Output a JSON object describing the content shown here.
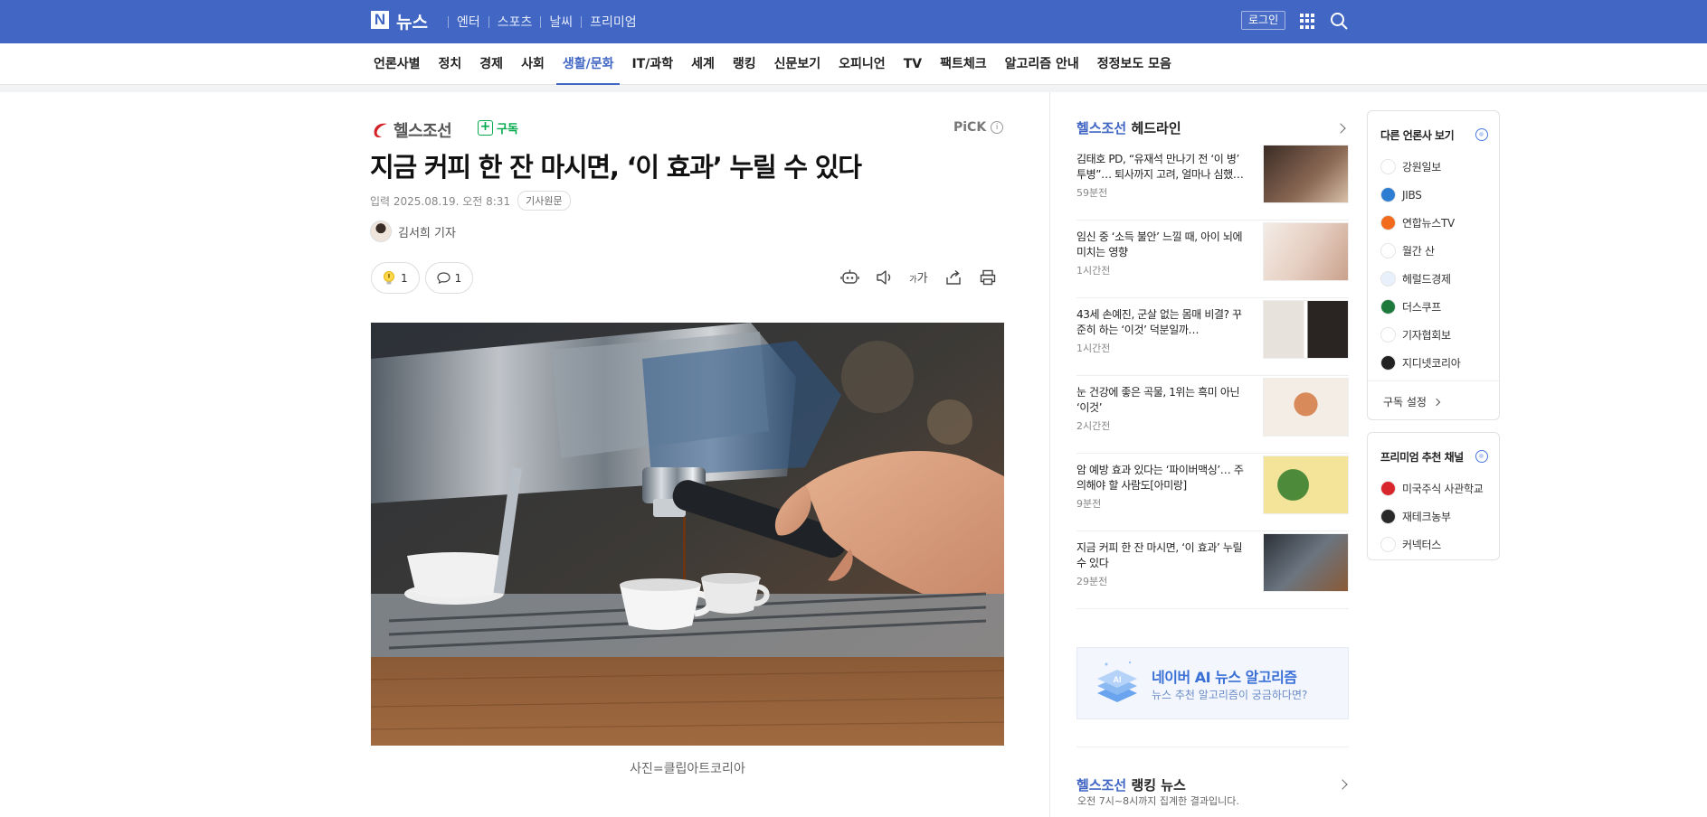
{
  "header": {
    "logo_letter": "N",
    "logo_text": "뉴스",
    "nav": [
      "엔터",
      "스포츠",
      "날씨",
      "프리미엄"
    ],
    "login_label": "로그인"
  },
  "section_nav": [
    "언론사별",
    "정치",
    "경제",
    "사회",
    "생활/문화",
    "IT/과학",
    "세계",
    "랭킹",
    "신문보기",
    "오피니언",
    "TV",
    "팩트체크",
    "알고리즘 안내",
    "정정보도 모음"
  ],
  "section_nav_active": "생활/문화",
  "article": {
    "press_name": "헬스조선",
    "subscribe_label": "구독",
    "pick_label": "PiCK",
    "title": "지금 커피 한 잔 마시면, ‘이 효과’ 누릴 수 있다",
    "date": "입력 2025.08.19. 오전 8:31",
    "original_label": "기사원문",
    "author": "김서희 기자",
    "reaction_count": "1",
    "comment_count": "1",
    "font_size_label": "가",
    "caption": "사진=클립아트코리아"
  },
  "sidebar": {
    "press_name": "헬스조선",
    "headline_label": "헤드라인",
    "items": [
      {
        "title": "김태호 PD, “유재석 만나기 전 ‘이 병’ 투병”… 퇴사까지 고려, 얼마나 심했길…",
        "time": "59분전"
      },
      {
        "title": "임신 중 ‘소득 불안’ 느낄 때, 아이 뇌에 미치는 영향",
        "time": "1시간전"
      },
      {
        "title": "43세 손예진, 군살 없는 몸매 비결? 꾸준히 하는 ‘이것’ 덕분일까…",
        "time": "1시간전"
      },
      {
        "title": "눈 건강에 좋은 곡물, 1위는 흑미 아닌 ‘이것’",
        "time": "2시간전"
      },
      {
        "title": "암 예방 효과 있다는 ‘파이버맥싱’… 주의해야 할 사람도[아미랑]",
        "time": "9분전"
      },
      {
        "title": "지금 커피 한 잔 마시면, ‘이 효과’ 누릴 수 있다",
        "time": "29분전"
      }
    ],
    "ai_title": "네이버 AI 뉴스 알고리즘",
    "ai_subtitle": "뉴스 추천 알고리즘이 궁금하다면?",
    "ai_icon_text": "AI",
    "ranking_label": "랭킹 뉴스",
    "ranking_sub": "오전 7시~8시까지 집계한 결과입니다."
  },
  "other_press": {
    "title": "다른 언론사 보기",
    "items": [
      {
        "name": "강원일보",
        "color": "#ffffff"
      },
      {
        "name": "JIBS",
        "color": "#2d7dd2"
      },
      {
        "name": "연합뉴스TV",
        "color": "#f26a1b"
      },
      {
        "name": "월간 산",
        "color": "#ffffff"
      },
      {
        "name": "헤럴드경제",
        "color": "#e8f1fb"
      },
      {
        "name": "더스쿠프",
        "color": "#1e7a3c"
      },
      {
        "name": "기자협회보",
        "color": "#ffffff"
      },
      {
        "name": "지디넷코리아",
        "color": "#222222"
      }
    ],
    "setting_label": "구독 설정"
  },
  "premium": {
    "title": "프리미엄 추천 채널",
    "items": [
      {
        "name": "미국주식 사관학교",
        "color": "#d9262d"
      },
      {
        "name": "재테크농부",
        "color": "#2a2a2a"
      },
      {
        "name": "커넥터스",
        "color": "#ffffff"
      }
    ]
  },
  "colors": {
    "brand_blue": "#4166c4",
    "subscribe_green": "#03a94d"
  }
}
